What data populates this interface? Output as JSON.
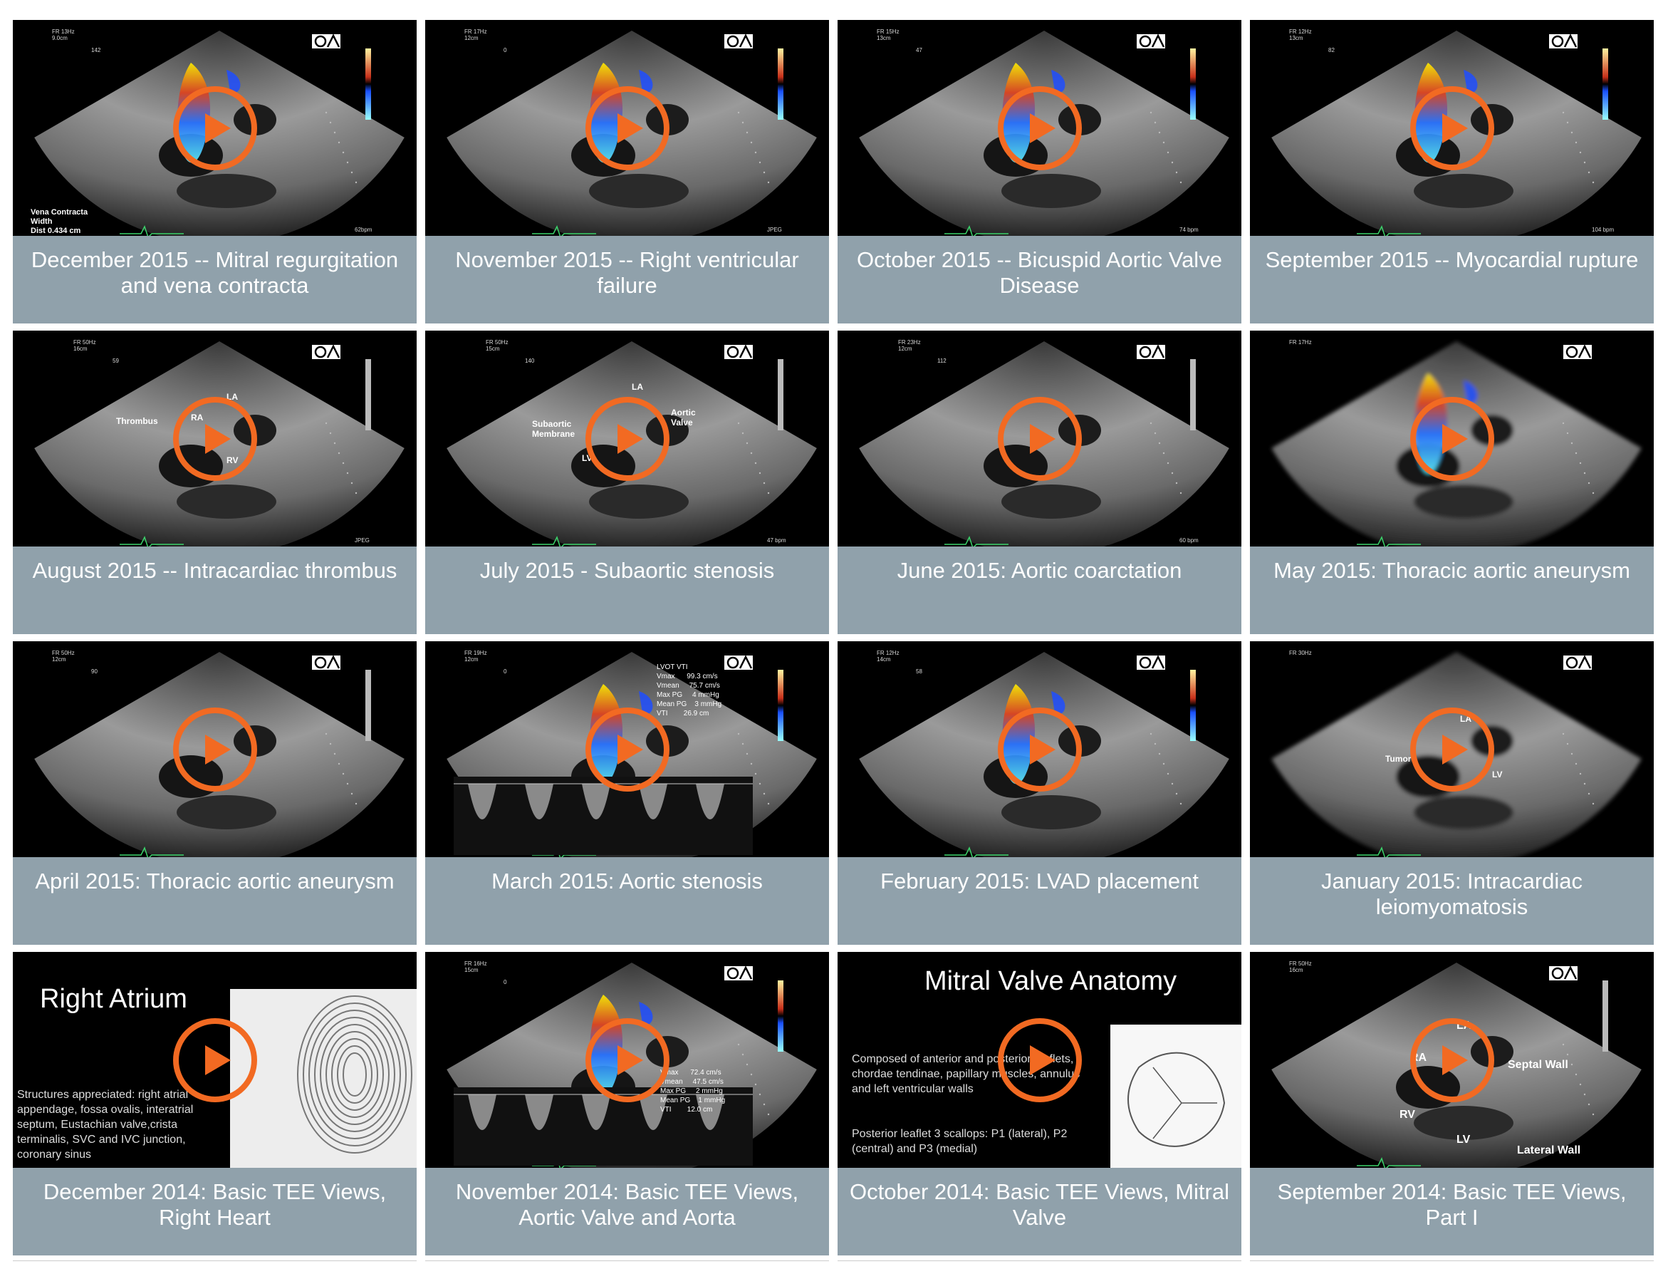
{
  "colors": {
    "caption_bg": "#90a1ab",
    "play_ring": "#f26a22",
    "thumb_bg": "#000000"
  },
  "icons": {
    "play": "play-circle-icon",
    "logo": "openanesthesia-logo-icon"
  },
  "tiles": [
    {
      "title": "December 2015 -- Mitral regurgitation and vena contracta",
      "scene": "color",
      "overlay": {
        "fr": "FR 13Hz",
        "depth": "9.0cm",
        "angle": "142",
        "bpm": "62bpm",
        "extra1": "Vena Contracta",
        "extra2": "Width",
        "extra3": "Dist  0.434 cm"
      }
    },
    {
      "title": "November 2015 -- Right ventricular failure",
      "scene": "color",
      "overlay": {
        "fr": "FR 17Hz",
        "depth": "12cm",
        "angle": "0",
        "bpm": "JPEG"
      }
    },
    {
      "title": "October 2015 -- Bicuspid Aortic Valve Disease",
      "scene": "color",
      "overlay": {
        "fr": "FR 15Hz",
        "depth": "13cm",
        "angle": "47",
        "bpm": "74 bpm"
      }
    },
    {
      "title": "September 2015 -- Myocardial rupture",
      "scene": "color",
      "overlay": {
        "fr": "FR 12Hz",
        "depth": "13cm",
        "angle": "82",
        "bpm": "104 bpm"
      }
    },
    {
      "title": "August 2015 -- Intracardiac thrombus",
      "scene": "gray",
      "overlay": {
        "fr": "FR 50Hz",
        "depth": "16cm",
        "angle": "59",
        "bpm": "JPEG",
        "lbl1": "Thrombus",
        "lbl2": "RA",
        "lbl3": "LA",
        "lbl4": "RV"
      }
    },
    {
      "title": "July 2015 - Subaortic stenosis",
      "scene": "gray",
      "overlay": {
        "fr": "FR 50Hz",
        "depth": "15cm",
        "angle": "140",
        "bpm": "47 bpm",
        "lbl1": "Subaortic",
        "lbl2": "Membrane",
        "lbl3": "Aortic",
        "lbl4": "Valve",
        "lbl5": "LA",
        "lbl6": "LV"
      }
    },
    {
      "title": "June 2015: Aortic coarctation",
      "scene": "gray",
      "overlay": {
        "fr": "FR 23Hz",
        "depth": "12cm",
        "angle": "112",
        "bpm": "60 bpm"
      }
    },
    {
      "title": "May 2015: Thoracic aortic aneurysm",
      "scene": "blur",
      "overlay": {
        "fr": "FR 17Hz",
        "depth": "",
        "angle": "",
        "bpm": ""
      }
    },
    {
      "title": "April 2015: Thoracic aortic aneurysm",
      "scene": "gray",
      "overlay": {
        "fr": "FR 50Hz",
        "depth": "12cm",
        "angle": "90",
        "bpm": ""
      }
    },
    {
      "title": "March 2015: Aortic stenosis",
      "scene": "doppler",
      "overlay": {
        "fr": "FR 19Hz",
        "depth": "12cm",
        "angle": "0",
        "bpm": "",
        "m1": "LVOT VTI",
        "m2": "Vmax      99.3 cm/s",
        "m3": "Vmean     75.7 cm/s",
        "m4": "Max PG     4 mmHg",
        "m5": "Mean PG    3 mmHg",
        "m6": "VTI        26.9 cm"
      }
    },
    {
      "title": "February 2015: LVAD placement",
      "scene": "color",
      "overlay": {
        "fr": "FR 12Hz",
        "depth": "14cm",
        "angle": "58",
        "bpm": ""
      }
    },
    {
      "title": "January 2015: Intracardiac leiomyomatosis",
      "scene": "blur-gray",
      "overlay": {
        "fr": "FR 30Hz",
        "depth": "",
        "angle": "",
        "bpm": "",
        "lbl1": "LA",
        "lbl2": "Tumor",
        "lbl3": "LV"
      }
    },
    {
      "title": "December 2014: Basic TEE Views, Right Heart",
      "scene": "slide-ra",
      "overlay": {
        "slide_title": "Right Atrium",
        "slide_text": "Structures appreciated:  right atrial appendage, fossa ovalis, interatrial septum, Eustachian valve,crista terminalis, SVC and IVC junction, coronary sinus"
      }
    },
    {
      "title": "November 2014: Basic TEE Views, Aortic Valve and Aorta",
      "scene": "doppler2",
      "overlay": {
        "fr": "FR 16Hz",
        "depth": "15cm",
        "angle": "0",
        "m1": "Vmax      72.4 cm/s",
        "m2": "Vmean     47.5 cm/s",
        "m3": "Max PG     2 mmHg",
        "m4": "Mean PG    1 mmHg",
        "m5": "VTI        12.0 cm"
      }
    },
    {
      "title": "October 2014: Basic TEE Views, Mitral Valve",
      "scene": "slide-mv",
      "overlay": {
        "slide_title": "Mitral Valve Anatomy",
        "b1": "Composed of anterior and posterior leaflets, chordae tendinae, papillary muscles, annulus and left ventricular walls",
        "b2": "Posterior leaflet 3 scallops: P1 (lateral), P2 (central) and P3 (medial)"
      }
    },
    {
      "title": "September 2014: Basic TEE Views, Part I",
      "scene": "gray",
      "overlay": {
        "fr": "FR 50Hz",
        "depth": "16cm",
        "angle": "",
        "bpm": "",
        "lbl1": "LA",
        "lbl2": "RA",
        "lbl3": "Septal Wall",
        "lbl4": "RV",
        "lbl5": "LV",
        "lbl6": "Lateral Wall"
      }
    }
  ]
}
